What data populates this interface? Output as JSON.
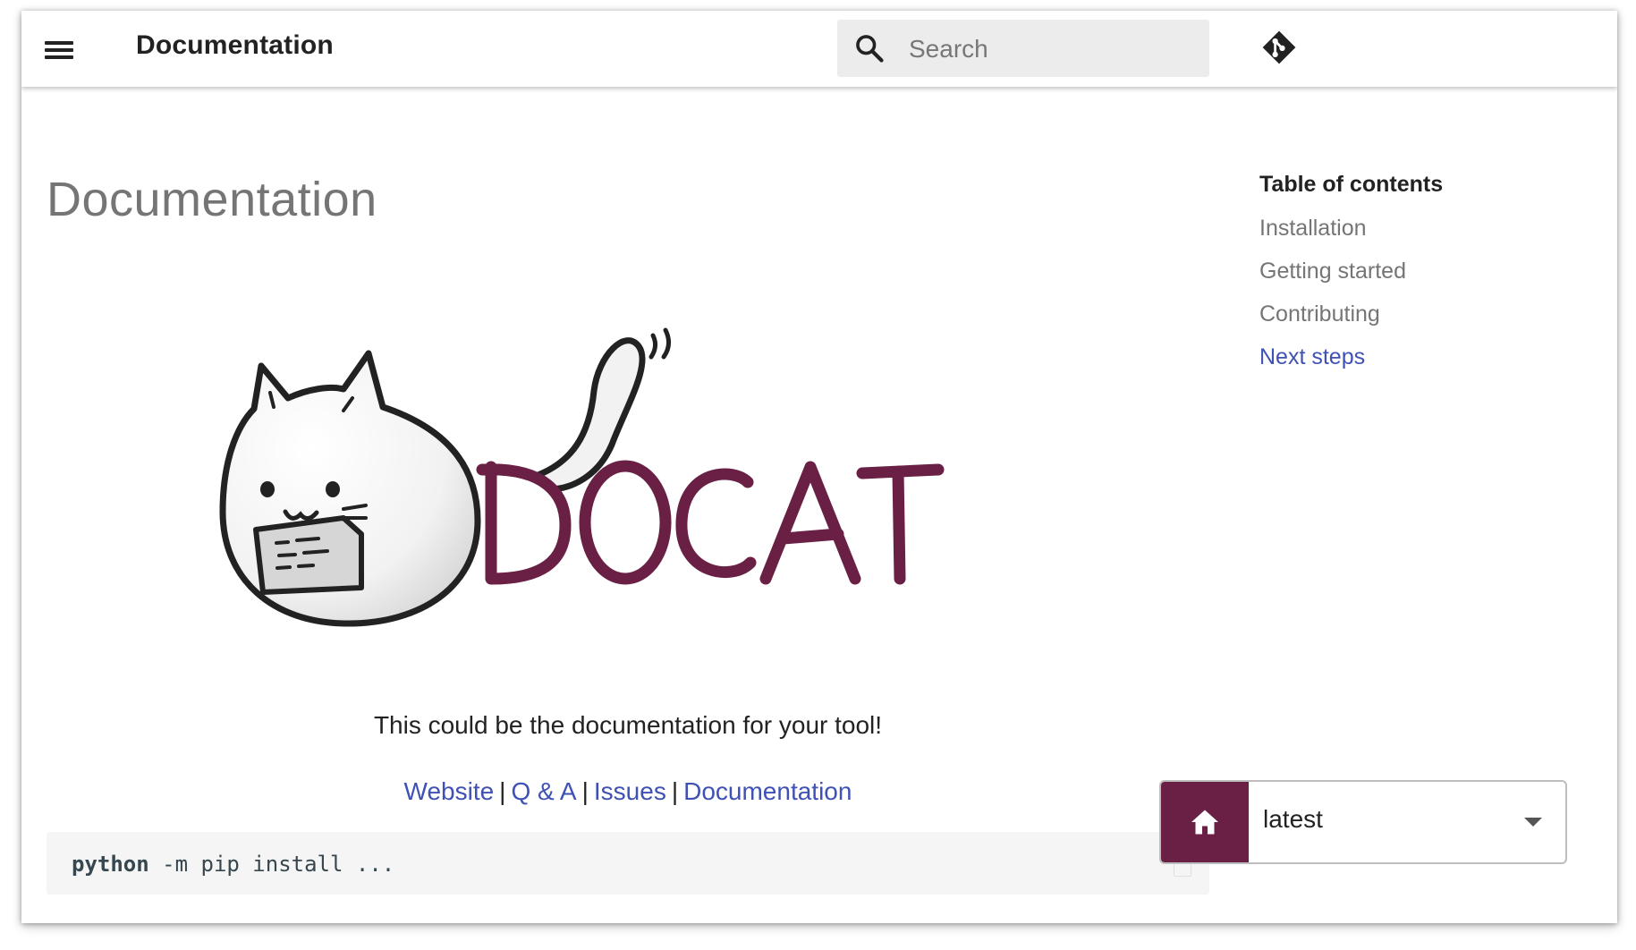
{
  "header": {
    "title": "Documentation",
    "search_placeholder": "Search",
    "menu_icon": "hamburger-menu-icon",
    "git_icon": "git-diamond-icon"
  },
  "main": {
    "page_title": "Documentation",
    "logo_text": "DOCAT",
    "tagline": "This could be the documentation for your tool!",
    "links": [
      {
        "label": "Website"
      },
      {
        "label": "Q & A"
      },
      {
        "label": "Issues"
      },
      {
        "label": "Documentation"
      }
    ],
    "link_separator": "|",
    "code": {
      "command": "python",
      "rest": " -m pip install ..."
    }
  },
  "toc": {
    "title": "Table of contents",
    "items": [
      {
        "label": "Installation",
        "active": false
      },
      {
        "label": "Getting started",
        "active": false
      },
      {
        "label": "Contributing",
        "active": false
      },
      {
        "label": "Next steps",
        "active": true
      }
    ]
  },
  "version_selector": {
    "home_icon": "home-icon",
    "selected": "latest"
  },
  "colors": {
    "brand": "#6a1f44",
    "link": "#3f51b5",
    "muted": "#757575"
  }
}
